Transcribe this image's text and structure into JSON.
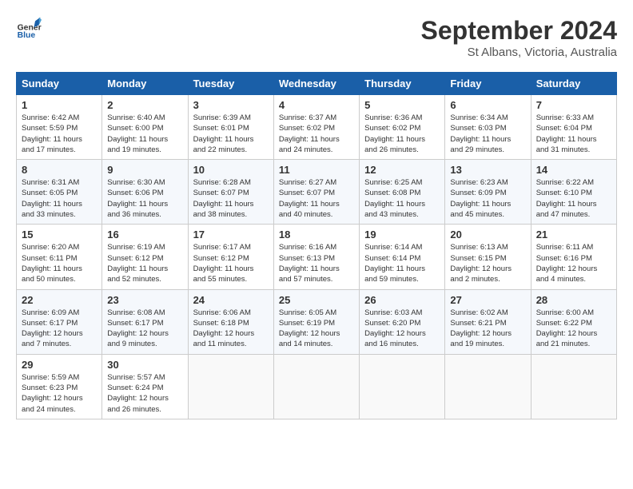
{
  "header": {
    "logo_line1": "General",
    "logo_line2": "Blue",
    "title": "September 2024",
    "subtitle": "St Albans, Victoria, Australia"
  },
  "weekdays": [
    "Sunday",
    "Monday",
    "Tuesday",
    "Wednesday",
    "Thursday",
    "Friday",
    "Saturday"
  ],
  "weeks": [
    [
      {
        "day": "1",
        "info": "Sunrise: 6:42 AM\nSunset: 5:59 PM\nDaylight: 11 hours\nand 17 minutes."
      },
      {
        "day": "2",
        "info": "Sunrise: 6:40 AM\nSunset: 6:00 PM\nDaylight: 11 hours\nand 19 minutes."
      },
      {
        "day": "3",
        "info": "Sunrise: 6:39 AM\nSunset: 6:01 PM\nDaylight: 11 hours\nand 22 minutes."
      },
      {
        "day": "4",
        "info": "Sunrise: 6:37 AM\nSunset: 6:02 PM\nDaylight: 11 hours\nand 24 minutes."
      },
      {
        "day": "5",
        "info": "Sunrise: 6:36 AM\nSunset: 6:02 PM\nDaylight: 11 hours\nand 26 minutes."
      },
      {
        "day": "6",
        "info": "Sunrise: 6:34 AM\nSunset: 6:03 PM\nDaylight: 11 hours\nand 29 minutes."
      },
      {
        "day": "7",
        "info": "Sunrise: 6:33 AM\nSunset: 6:04 PM\nDaylight: 11 hours\nand 31 minutes."
      }
    ],
    [
      {
        "day": "8",
        "info": "Sunrise: 6:31 AM\nSunset: 6:05 PM\nDaylight: 11 hours\nand 33 minutes."
      },
      {
        "day": "9",
        "info": "Sunrise: 6:30 AM\nSunset: 6:06 PM\nDaylight: 11 hours\nand 36 minutes."
      },
      {
        "day": "10",
        "info": "Sunrise: 6:28 AM\nSunset: 6:07 PM\nDaylight: 11 hours\nand 38 minutes."
      },
      {
        "day": "11",
        "info": "Sunrise: 6:27 AM\nSunset: 6:07 PM\nDaylight: 11 hours\nand 40 minutes."
      },
      {
        "day": "12",
        "info": "Sunrise: 6:25 AM\nSunset: 6:08 PM\nDaylight: 11 hours\nand 43 minutes."
      },
      {
        "day": "13",
        "info": "Sunrise: 6:23 AM\nSunset: 6:09 PM\nDaylight: 11 hours\nand 45 minutes."
      },
      {
        "day": "14",
        "info": "Sunrise: 6:22 AM\nSunset: 6:10 PM\nDaylight: 11 hours\nand 47 minutes."
      }
    ],
    [
      {
        "day": "15",
        "info": "Sunrise: 6:20 AM\nSunset: 6:11 PM\nDaylight: 11 hours\nand 50 minutes."
      },
      {
        "day": "16",
        "info": "Sunrise: 6:19 AM\nSunset: 6:12 PM\nDaylight: 11 hours\nand 52 minutes."
      },
      {
        "day": "17",
        "info": "Sunrise: 6:17 AM\nSunset: 6:12 PM\nDaylight: 11 hours\nand 55 minutes."
      },
      {
        "day": "18",
        "info": "Sunrise: 6:16 AM\nSunset: 6:13 PM\nDaylight: 11 hours\nand 57 minutes."
      },
      {
        "day": "19",
        "info": "Sunrise: 6:14 AM\nSunset: 6:14 PM\nDaylight: 11 hours\nand 59 minutes."
      },
      {
        "day": "20",
        "info": "Sunrise: 6:13 AM\nSunset: 6:15 PM\nDaylight: 12 hours\nand 2 minutes."
      },
      {
        "day": "21",
        "info": "Sunrise: 6:11 AM\nSunset: 6:16 PM\nDaylight: 12 hours\nand 4 minutes."
      }
    ],
    [
      {
        "day": "22",
        "info": "Sunrise: 6:09 AM\nSunset: 6:17 PM\nDaylight: 12 hours\nand 7 minutes."
      },
      {
        "day": "23",
        "info": "Sunrise: 6:08 AM\nSunset: 6:17 PM\nDaylight: 12 hours\nand 9 minutes."
      },
      {
        "day": "24",
        "info": "Sunrise: 6:06 AM\nSunset: 6:18 PM\nDaylight: 12 hours\nand 11 minutes."
      },
      {
        "day": "25",
        "info": "Sunrise: 6:05 AM\nSunset: 6:19 PM\nDaylight: 12 hours\nand 14 minutes."
      },
      {
        "day": "26",
        "info": "Sunrise: 6:03 AM\nSunset: 6:20 PM\nDaylight: 12 hours\nand 16 minutes."
      },
      {
        "day": "27",
        "info": "Sunrise: 6:02 AM\nSunset: 6:21 PM\nDaylight: 12 hours\nand 19 minutes."
      },
      {
        "day": "28",
        "info": "Sunrise: 6:00 AM\nSunset: 6:22 PM\nDaylight: 12 hours\nand 21 minutes."
      }
    ],
    [
      {
        "day": "29",
        "info": "Sunrise: 5:59 AM\nSunset: 6:23 PM\nDaylight: 12 hours\nand 24 minutes."
      },
      {
        "day": "30",
        "info": "Sunrise: 5:57 AM\nSunset: 6:24 PM\nDaylight: 12 hours\nand 26 minutes."
      },
      {
        "day": "",
        "info": ""
      },
      {
        "day": "",
        "info": ""
      },
      {
        "day": "",
        "info": ""
      },
      {
        "day": "",
        "info": ""
      },
      {
        "day": "",
        "info": ""
      }
    ]
  ]
}
